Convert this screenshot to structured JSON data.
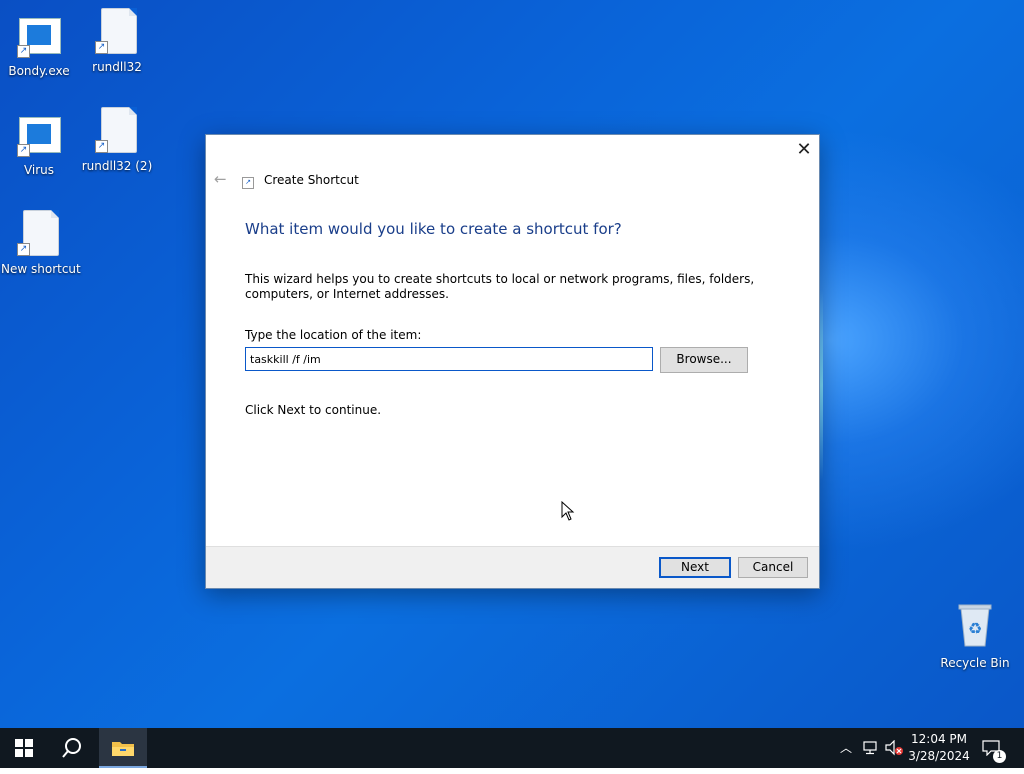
{
  "desktop": {
    "icons": [
      {
        "label": "Bondy.exe"
      },
      {
        "label": "rundll32"
      },
      {
        "label": "Virus"
      },
      {
        "label": "rundll32 (2)"
      },
      {
        "label": "New shortcut"
      },
      {
        "label": "Recycle Bin"
      }
    ]
  },
  "dialog": {
    "title": "Create Shortcut",
    "heading": "What item would you like to create a shortcut for?",
    "description": "This wizard helps you to create shortcuts to local or network programs, files, folders, computers, or Internet addresses.",
    "location_label": "Type the location of the item:",
    "location_value": "taskkill /f /im",
    "browse_label": "Browse...",
    "hint": "Click Next to continue.",
    "next_label": "Next",
    "cancel_label": "Cancel",
    "close_glyph": "✕",
    "back_glyph": "←"
  },
  "taskbar": {
    "time": "12:04 PM",
    "date": "3/28/2024",
    "notification_count": "1"
  },
  "colors": {
    "accent": "#0a58c9",
    "heading": "#1a3e8a",
    "taskbar": "#101820"
  }
}
